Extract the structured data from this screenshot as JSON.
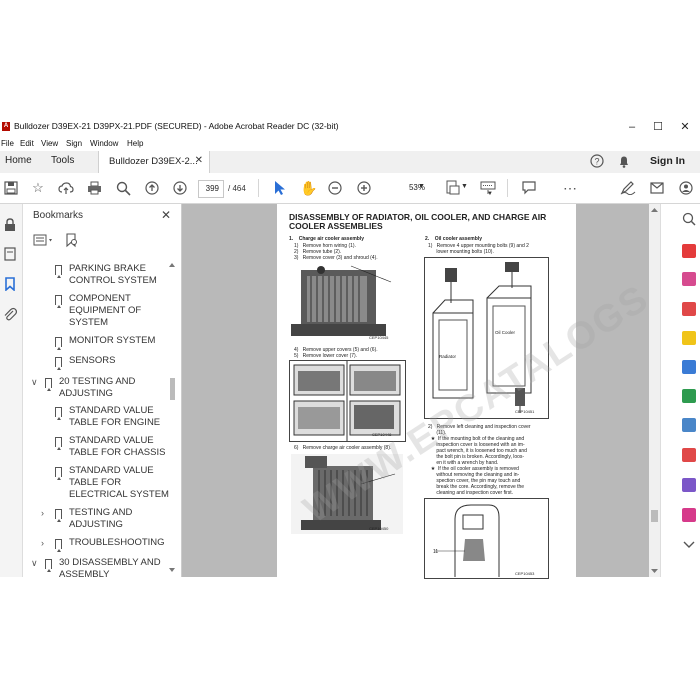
{
  "window": {
    "title": "Bulldozer D39EX-21 D39PX-21.PDF (SECURED) - Adobe Acrobat Reader DC (32-bit)",
    "controls": [
      "–",
      "☐",
      "✕"
    ]
  },
  "menu": [
    "File",
    "Edit",
    "View",
    "Sign",
    "Window",
    "Help"
  ],
  "tabs": {
    "home": "Home",
    "tools": "Tools",
    "document": "Bulldozer D39EX-2...",
    "sign_in": "Sign In"
  },
  "toolbar": {
    "current_page": "399",
    "page_total": "/ 464",
    "zoom": "53%"
  },
  "bookmarks": {
    "header": "Bookmarks",
    "items": [
      {
        "label": "PARKING BRAKE\nCONTROL SYSTEM"
      },
      {
        "label": "COMPONENT\nEQUIPMENT OF\nSYSTEM"
      },
      {
        "label": "MONITOR SYSTEM"
      },
      {
        "label": "SENSORS"
      },
      {
        "label": "20 TESTING AND\nADJUSTING"
      },
      {
        "label": "STANDARD VALUE\nTABLE FOR ENGINE"
      },
      {
        "label": "STANDARD VALUE\nTABLE FOR CHASSIS"
      },
      {
        "label": "STANDARD VALUE\nTABLE FOR\nELECTRICAL SYSTEM"
      },
      {
        "label": "TESTING AND\nADJUSTING"
      },
      {
        "label": "TROUBLESHOOTING"
      },
      {
        "label": "30 DISASSEMBLY AND\nASSEMBLY"
      }
    ]
  },
  "document": {
    "heading": "DISASSEMBLY OF RADIATOR, OIL COOLER, AND CHARGE AIR COOLER ASSEMBLIES",
    "section1_title": "1.    Charge air cooler assembly",
    "section1_steps": "1)   Remove horn wiring (1).\n2)   Remove tube (2).\n3)   Remove cover (3) and shroud (4).",
    "section1_steps2": "4)   Remove upper covers (5) and (6).\n5)   Remove lower cover (7).",
    "section1_steps3": "6)   Remove charge air cooler assembly (8).",
    "section2_title": "2.    Oil cooler assembly",
    "section2_steps": "1)   Remove 4 upper mounting bolts (9) and 2\n      lower mounting bolts (10).",
    "section2_steps2": "2)   Remove left cleaning and inspection cover\n      (11).\n  ★  If the mounting bolt of the cleaning and\n      inspection cover is loosened with an im-\n      pact wrench, it is loosened too much and\n      the bolt pin is broken. Accordingly, loos-\n      en it with a wrench by hand.\n  ★  If the oil cooler assembly is removed\n      without removing the cleaning and in-\n      spection cover, the pin may touch and\n      break the core. Accordingly, remove the\n      cleaning and inspection cover first.",
    "fig1_code": "CEP10445",
    "fig2_code": "CEP10448",
    "fig3_code": "CEP10450",
    "fig4_code": "CEP10451",
    "fig5_code": "CEP10453",
    "label_radiator": "Radiator",
    "label_oilcooler": "Oil Cooler",
    "watermark": "WWW.EPCATALOGS.COM"
  }
}
